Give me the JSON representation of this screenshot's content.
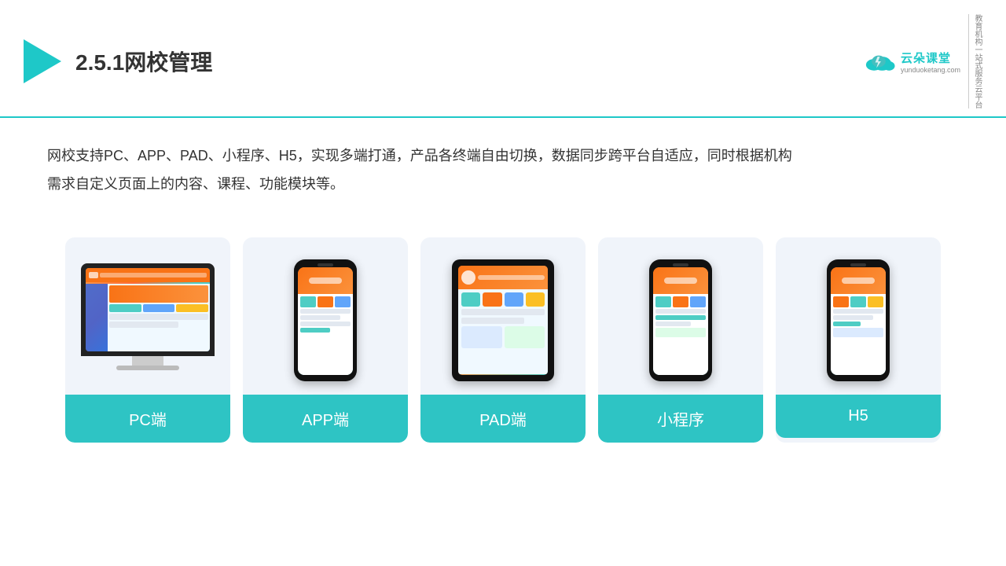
{
  "header": {
    "title": "2.5.1网校管理",
    "brand": {
      "name": "云朵课堂",
      "url": "yunduoketang.com",
      "tagline": "教育机构一站式服务云平台"
    }
  },
  "description": {
    "text": "网校支持PC、APP、PAD、小程序、H5，实现多端打通，产品各终端自由切换，数据同步跨平台自适应，同时根据机构需求自定义页面上的内容、课程、功能模块等。"
  },
  "cards": [
    {
      "id": "pc",
      "label": "PC端",
      "type": "pc"
    },
    {
      "id": "app",
      "label": "APP端",
      "type": "phone"
    },
    {
      "id": "pad",
      "label": "PAD端",
      "type": "tablet"
    },
    {
      "id": "miniprogram",
      "label": "小程序",
      "type": "phone"
    },
    {
      "id": "h5",
      "label": "H5",
      "type": "phone"
    }
  ],
  "colors": {
    "accent": "#1ec8c8",
    "card_bg": "#edf1f9",
    "card_label_bg": "#2ec4c4",
    "text_dark": "#333333"
  }
}
